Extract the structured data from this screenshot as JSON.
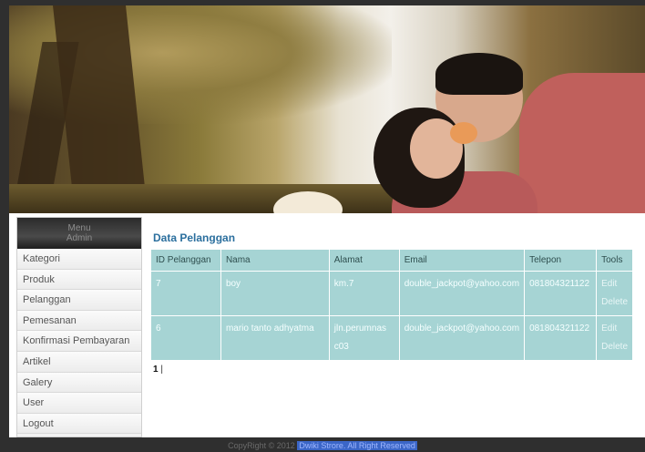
{
  "sidebar": {
    "header_line1": "Menu",
    "header_line2": "Admin",
    "items": [
      {
        "label": "Kategori"
      },
      {
        "label": "Produk"
      },
      {
        "label": "Pelanggan"
      },
      {
        "label": "Pemesanan"
      },
      {
        "label": "Konfirmasi Pembayaran"
      },
      {
        "label": "Artikel"
      },
      {
        "label": "Galery"
      },
      {
        "label": "User"
      },
      {
        "label": "Logout"
      }
    ]
  },
  "main": {
    "title": "Data Pelanggan",
    "table": {
      "headers": [
        "ID Pelanggan",
        "Nama",
        "Alamat",
        "Email",
        "Telepon",
        "Tools"
      ],
      "rows": [
        {
          "id": "7",
          "nama": "boy",
          "alamat": "km.7",
          "email": "double_jackpot@yahoo.com",
          "telepon": "081804321122",
          "edit": "Edit",
          "delete": "Delete"
        },
        {
          "id": "6",
          "nama": "mario tanto adhyatma",
          "alamat": "jln.perumnas c03",
          "email": "double_jackpot@yahoo.com",
          "telepon": "081804321122",
          "edit": "Edit",
          "delete": "Delete"
        }
      ]
    },
    "pager": {
      "current": "1",
      "separator": "|"
    }
  },
  "footer": {
    "copyright": "CopyRight © 2012",
    "link": "Dwiki Strore. All Right Reserved"
  },
  "colors": {
    "accent": "#2b6f9e",
    "table_bg": "#a6d4d4"
  }
}
